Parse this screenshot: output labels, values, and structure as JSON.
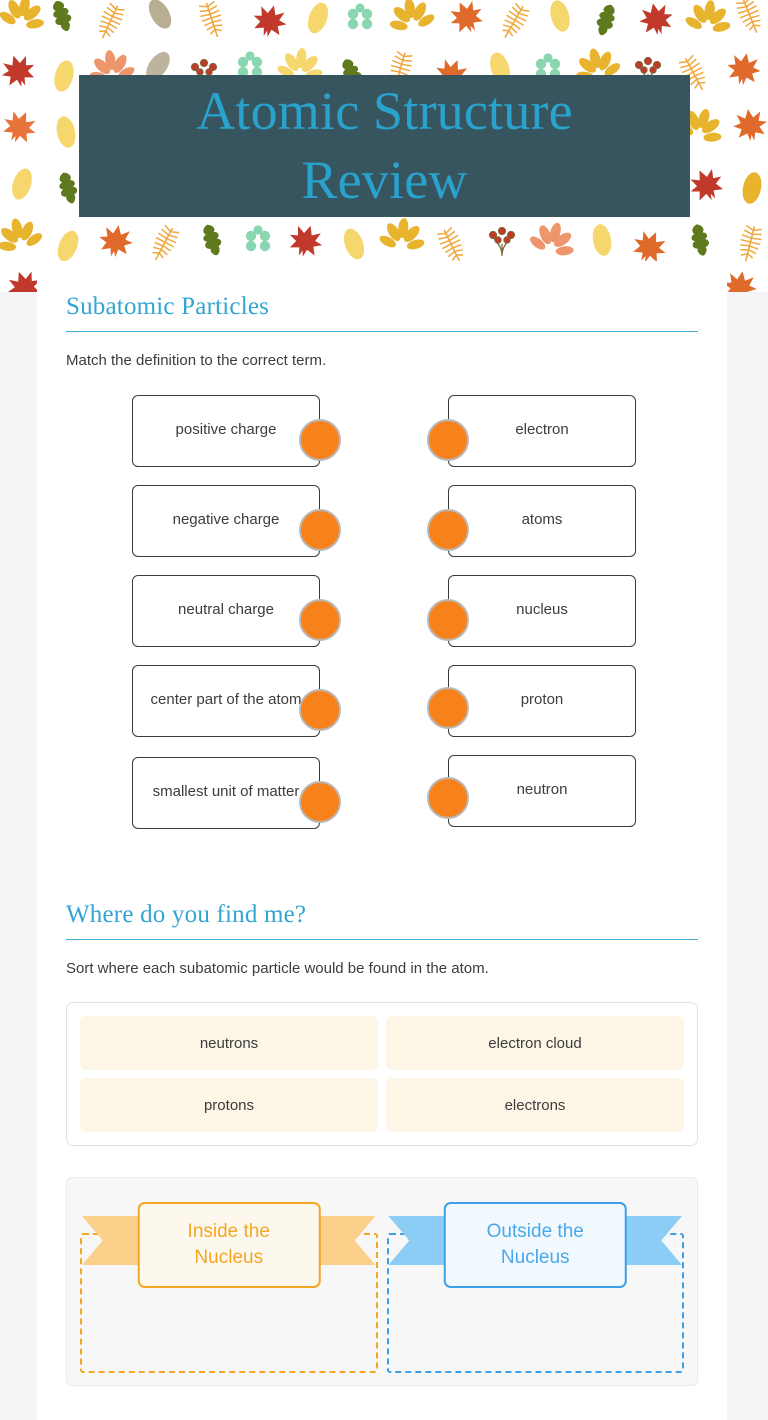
{
  "header": {
    "title_line1": "Atomic Structure",
    "title_line2": "Review",
    "band_color": "#37555f",
    "title_color": "#29a2cd",
    "background_pattern": "autumn-leaves"
  },
  "sections": [
    {
      "heading": "Subatomic Particles",
      "instruction": "Match the definition to the correct term."
    },
    {
      "heading": "Where do you find me?",
      "instruction": "Sort where each subatomic particle would be found in the atom."
    }
  ],
  "matching": {
    "left_items": [
      "positive charge",
      "negative charge",
      "neutral charge",
      "center part of the atom",
      "smallest unit of matter"
    ],
    "right_items": [
      "electron",
      "atoms",
      "nucleus",
      "proton",
      "neutron"
    ],
    "dot_color": "#f7821b",
    "dot_ring_color": "#b9b9b9"
  },
  "sorting": {
    "wordbank": [
      "neutrons",
      "electron cloud",
      "protons",
      "electrons"
    ],
    "tile_color": "#fdf6e6",
    "categories": [
      {
        "label_line1": "Inside the",
        "label_line2": "Nucleus",
        "accent": "#f5a623",
        "tail": "#fbd08a",
        "fill": "#fdf8ee"
      },
      {
        "label_line1": "Outside the",
        "label_line2": "Nucleus",
        "accent": "#3ba0e8",
        "tail": "#8ccdf6",
        "fill": "#f2f9fe"
      }
    ]
  }
}
